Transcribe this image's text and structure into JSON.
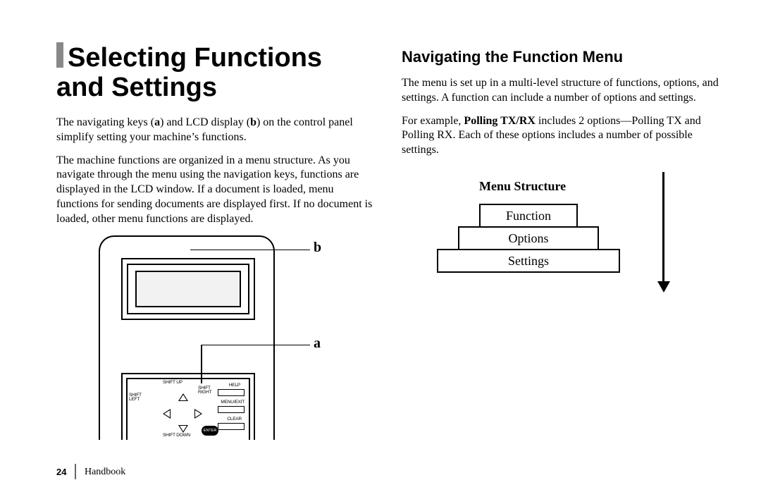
{
  "title": "Selecting Functions and Settings",
  "left": {
    "p1_pre": "The navigating keys (",
    "p1_a": "a",
    "p1_mid": ") and LCD display (",
    "p1_b": "b",
    "p1_post": ")  on the control panel simplify setting your machine’s functions.",
    "p2": "The machine functions are organized in a menu structure. As you navigate through the menu using the navigation keys, functions are displayed in the LCD window. If a document is loaded, menu functions for sending documents are displayed first. If no document is loaded, other menu functions are displayed."
  },
  "right": {
    "heading": "Navigating the Function Menu",
    "p1": "The menu is set up in a multi-level structure of functions, options, and settings. A function can include a number of options and settings.",
    "p2_pre": "For example, ",
    "p2_bold": "Polling TX/RX",
    "p2_post": "  includes 2 options—Polling TX and Polling RX. Each of these options includes a number of possible settings."
  },
  "figure": {
    "callout_b": "b",
    "callout_a": "a",
    "labels": {
      "shift_up": "SHIFT UP",
      "shift_down": "SHIFT DOWN",
      "shift_left": "SHIFT LEFT",
      "shift_right": "SHIFT RIGHT",
      "help": "HELP",
      "menu_exit": "MENU/EXIT",
      "clear": "CLEAR",
      "enter": "ENTER"
    }
  },
  "menu_structure": {
    "title": "Menu Structure",
    "function": "Function",
    "options": "Options",
    "settings": "Settings"
  },
  "footer": {
    "page": "24",
    "book": "Handbook"
  }
}
